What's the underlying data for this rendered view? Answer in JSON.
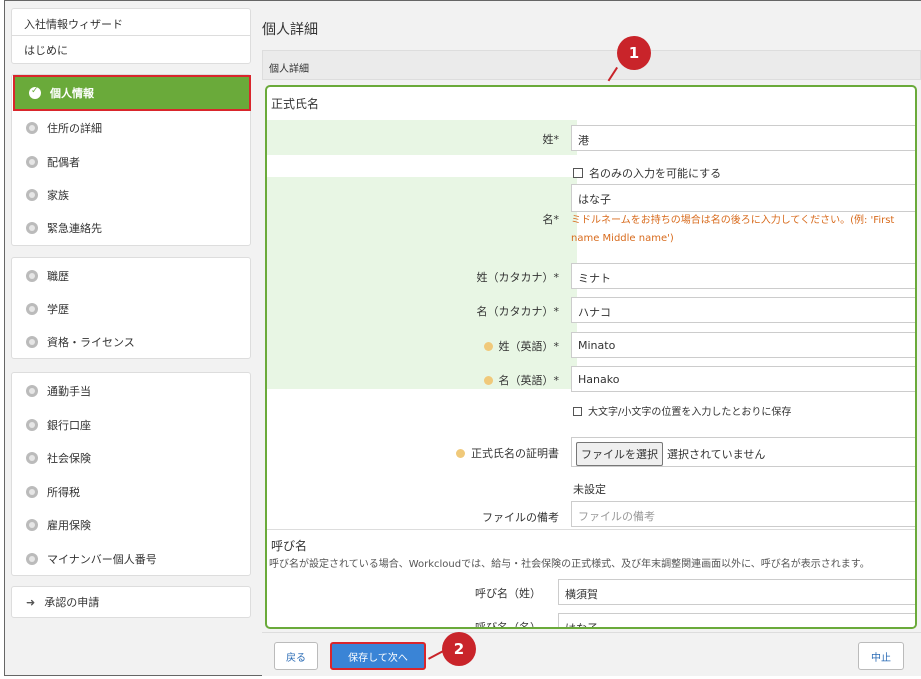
{
  "sidebar": {
    "group1": [
      {
        "label": "入社情報ウィザード"
      },
      {
        "label": "はじめに"
      }
    ],
    "group2": [
      {
        "label": "個人情報",
        "active": true
      },
      {
        "label": "住所の詳細"
      },
      {
        "label": "配偶者"
      },
      {
        "label": "家族"
      },
      {
        "label": "緊急連絡先"
      }
    ],
    "group3": [
      {
        "label": "職歴"
      },
      {
        "label": "学歴"
      },
      {
        "label": "資格・ライセンス"
      }
    ],
    "group4": [
      {
        "label": "通勤手当"
      },
      {
        "label": "銀行口座"
      },
      {
        "label": "社会保険"
      },
      {
        "label": "所得税"
      },
      {
        "label": "雇用保険"
      },
      {
        "label": "マイナンバー個人番号"
      }
    ],
    "submit": {
      "label": "承認の申請"
    }
  },
  "main": {
    "page_title": "個人詳細",
    "panel_header": "個人詳細",
    "legal_name_section": "正式氏名",
    "fields": {
      "last_name": {
        "label": "姓*",
        "value": "港"
      },
      "first_name_only": {
        "label": "名のみの入力を可能にする"
      },
      "first_name": {
        "label": "名*",
        "value": "はな子",
        "hint_line1": "ミドルネームをお持ちの場合は名の後ろに入力してください。(例: 'First",
        "hint_line2": "name Middle name')"
      },
      "last_name_kana": {
        "label": "姓（カタカナ）*",
        "value": "ミナト"
      },
      "first_name_kana": {
        "label": "名（カタカナ）*",
        "value": "ハナコ"
      },
      "last_name_en": {
        "label": "姓（英語）*",
        "value": "Minato"
      },
      "first_name_en": {
        "label": "名（英語）*",
        "value": "Hanako"
      },
      "keep_case": {
        "label": "大文字/小文字の位置を入力したとおりに保存"
      },
      "proof": {
        "label": "正式氏名の証明書",
        "button": "ファイルを選択",
        "status": "選択されていません"
      },
      "unset": "未設定",
      "file_note": {
        "label": "ファイルの備考",
        "placeholder": "ファイルの備考"
      }
    },
    "nickname_section": "呼び名",
    "nickname_desc": "呼び名が設定されている場合、Workcloudでは、給与・社会保険の正式様式、及び年末調整関連画面以外に、呼び名が表示されます。",
    "nickname_fields": {
      "last": {
        "label": "呼び名（姓）",
        "value": "横須賀"
      },
      "first": {
        "label": "呼び名（名）",
        "value": "はな子"
      }
    }
  },
  "footer": {
    "back": "戻る",
    "save_next": "保存して次へ",
    "cancel": "中止"
  },
  "callouts": {
    "one": "1",
    "two": "2"
  },
  "colors": {
    "accent_green": "#6aaa3a",
    "callout_red": "#c9242a",
    "primary_blue": "#3a84d6",
    "hint_orange": "#d86b1d"
  }
}
